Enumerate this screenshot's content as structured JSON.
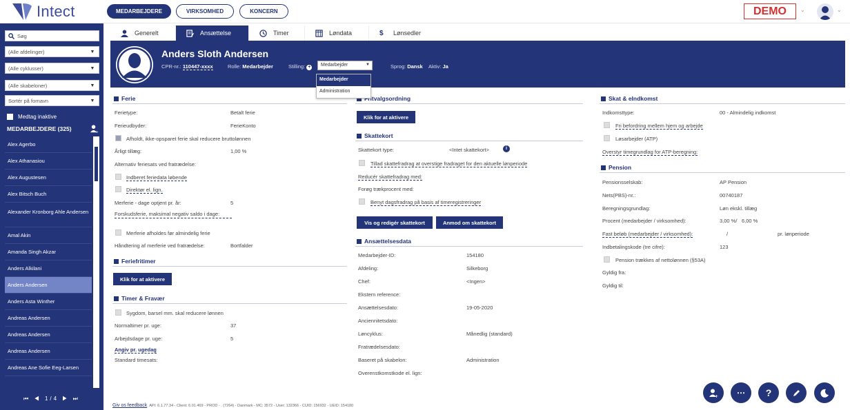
{
  "app": {
    "logo_text": "Intect",
    "demo": "DEMO"
  },
  "nav": {
    "employees": "MEDARBEJDERE",
    "company": "VIRKSOMHED",
    "group": "KONCERN"
  },
  "sidebar": {
    "search_placeholder": "Søg",
    "department": "(Alle afdelinger)",
    "cycle": "(Alle cyklusser)",
    "template": "(Alle skabeloner)",
    "sort": "Sortér på fornavn",
    "include_inactive": "Medtag inaktive",
    "list_header": "MEDARBEJDERE (325)",
    "employees": [
      "Alex Agerbo",
      "Alex Athanasiou",
      "Alex Augustesen",
      "Alex Bitsch Buch",
      "Alexander Kronborg Ahle Andersen",
      "Amal Akin",
      "Amanda Singh Akzar",
      "Anders Alkilani",
      "Anders Andersen",
      "Anders Asta Winther",
      "Andreas Andersen",
      "Andreas Andersen",
      "Andreas Andersen",
      "Andreas Ane Sofie Eeg-Larsen"
    ],
    "selected_index": 8,
    "pager": {
      "first": "⏮",
      "prev": "◀",
      "page": "1/4",
      "next": "▶",
      "last": "⏭"
    }
  },
  "tabs": [
    "Generelt",
    "Ansættelse",
    "Timer",
    "Løndata",
    "Lønsedler"
  ],
  "active_tab": 1,
  "employee": {
    "name": "Anders Sloth Andersen",
    "cpr_label": "CPR-nr.:",
    "cpr": "110447-xxxx",
    "role_label": "Rolle:",
    "role": "Medarbejder",
    "position_label": "Stilling:",
    "position_value": "Medarbejder",
    "position_options": [
      "Medarbejder",
      "Administration"
    ],
    "lang_label": "Sprog:",
    "lang": "Dansk",
    "active_label": "Aktiv:",
    "active": "Ja"
  },
  "ferie": {
    "title": "Ferie",
    "type_label": "Ferietype:",
    "type_value": "Betalt ferie",
    "provider_label": "Ferieudbyder:",
    "provider_value": "FerieKonto",
    "reduce_label": "Afholdt, ikke-opsparet ferie skal reducere bruttolønnen",
    "annual_label": "Årligt tillæg:",
    "annual_value": "1,00 %",
    "alt_label": "Alternativ feriesats ved fratrædelse:",
    "ongoing_label": "Indberet feriedata løbende",
    "director_label": "Direktør el. lign.",
    "extra_days_label": "Merferie - dage optjent pr. år:",
    "extra_days_value": "5",
    "advance_label": "Forskudsferie, maksimal negativ saldo i dage:",
    "extra_first_label": "Merferie afholdes før almindelig ferie",
    "handling_label": "Håndtering af merferie ved fratrædelse:",
    "handling_value": "Bortfalder"
  },
  "ferie_fri": {
    "title": "Feriefritimer",
    "activate": "Klik for at aktivere"
  },
  "timer": {
    "title": "Timer & Fravær",
    "sick_label": "Sygdom, barsel mm. skal reducere lønnen",
    "normal_label": "Normaltimer pr. uge:",
    "normal_value": "37",
    "days_label": "Arbejdsdage pr. uge:",
    "days_value": "5",
    "weekday_link": "Angiv pr. ugedag",
    "rate_label": "Standard timesats:"
  },
  "fritvalg": {
    "title": "Fritvalgsordning",
    "activate": "Klik for at aktivere"
  },
  "skattekort": {
    "title": "Skattekort",
    "type_label": "Skattekort type:",
    "type_value": "<Intet skattekort>",
    "allow_label": "Tillad skattefradrag at overstige fradraget for den aktuelle lønperiode",
    "reduce_label": "Reducér skattefradrag med:",
    "increase_label": "Forøg trækprocent med:",
    "daily_label": "Benyt dagsfradrag på basis af timeregistreringer",
    "view_btn": "Vis og redigér skattekort",
    "request_btn": "Anmod om skattekort"
  },
  "ansaettelse": {
    "title": "Ansættelsesdata",
    "rows": [
      {
        "label": "Medarbejder-ID:",
        "value": "154180"
      },
      {
        "label": "Afdeling:",
        "value": "Silkeborg"
      },
      {
        "label": "Chef:",
        "value": "<Ingen>"
      },
      {
        "label": "Ekstern reference:",
        "value": ""
      },
      {
        "label": "Ansættelsesdato:",
        "value": "19-05-2020"
      },
      {
        "label": "Anciennitetsdato:",
        "value": ""
      },
      {
        "label": "Løncyklus:",
        "value": "Månedlig (standard)"
      },
      {
        "label": "Fratrædelsesdato:",
        "value": ""
      },
      {
        "label": "Baseret på skabelon:",
        "value": "Administration"
      },
      {
        "label": "Overenstkomstkode el. lign:",
        "value": ""
      }
    ]
  },
  "skat": {
    "title": "Skat & eIndkomst",
    "income_label": "Indkomsttype:",
    "income_value": "00 - Almindelig indkomst",
    "transport_label": "Fri befordring mellem hjem og arbejde",
    "atp_label": "Løsarbejder (ATP)",
    "override_label": "Overstyr timegrundlag for ATP-beregning:"
  },
  "pension": {
    "title": "Pension",
    "company_label": "Pensionsselskab:",
    "company_value": "AP Pension",
    "nets_label": "Nets(PBS)-nr.:",
    "nets_value": "00740187",
    "basis_label": "Beregningsgrundlag:",
    "basis_value": "Løn ekskl. tillæg",
    "pct_label": "Procent (medarbejder / virksomhed):",
    "pct_emp": "3,00 %/",
    "pct_comp": "6,00 %",
    "fixed_label": "Fast beløb (medarbejder / virksomhed):",
    "fixed_sep": "/",
    "fixed_unit": "pr. lønperiode",
    "code_label": "Indbetalingskode (tre cifre):",
    "code_value": "123",
    "net_label": "Pension trækkes af nettolønnen (§53A)",
    "from_label": "Gyldig fra:",
    "to_label": "Gyldig til:"
  },
  "footer": {
    "feedback": "Giv os feedback",
    "info": "API: 6.1.77.34 - Client: 6.01.469 - PROD - . (7264) - Danmark - MC: 3572 - User: 132366 - CUID: 156932 - UEID: 154180"
  },
  "colors": {
    "primary": "#243478",
    "selected": "#7385c6",
    "demo": "#d43030"
  }
}
